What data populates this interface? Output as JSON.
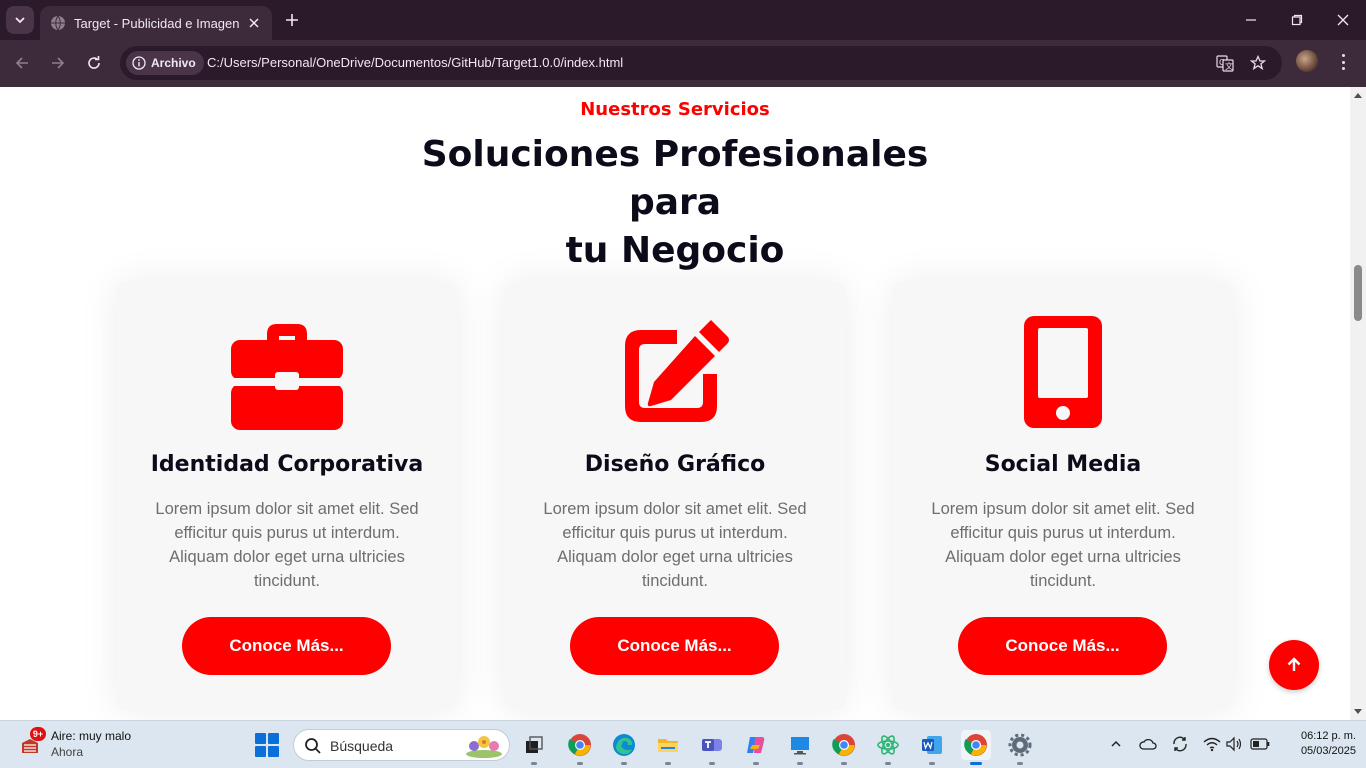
{
  "browser": {
    "tab_title": "Target - Publicidad e Imagen",
    "chip_label": "Archivo",
    "url": "C:/Users/Personal/OneDrive/Documentos/GitHub/Target1.0.0/index.html"
  },
  "page": {
    "eyebrow": "Nuestros Servicios",
    "heading_line1": "Soluciones Profesionales para",
    "heading_line2": "tu Negocio",
    "accent_color": "#ff0000",
    "cards": [
      {
        "icon": "briefcase-icon",
        "title": "Identidad Corporativa",
        "text": "Lorem ipsum dolor sit amet elit. Sed efficitur quis purus ut interdum. Aliquam dolor eget urna ultricies tincidunt.",
        "button": "Conoce Más..."
      },
      {
        "icon": "pencil-square-icon",
        "title": "Diseño Gráfico",
        "text": "Lorem ipsum dolor sit amet elit. Sed efficitur quis purus ut interdum. Aliquam dolor eget urna ultricies tincidunt.",
        "button": "Conoce Más..."
      },
      {
        "icon": "mobile-phone-icon",
        "title": "Social Media",
        "text": "Lorem ipsum dolor sit amet elit. Sed efficitur quis purus ut interdum. Aliquam dolor eget urna ultricies tincidunt.",
        "button": "Conoce Más..."
      }
    ]
  },
  "taskbar": {
    "weather_badge": "9+",
    "weather_title": "Aire: muy malo",
    "weather_sub": "Ahora",
    "search_placeholder": "Búsqueda",
    "time": "06:12 p. m.",
    "date": "05/03/2025"
  }
}
